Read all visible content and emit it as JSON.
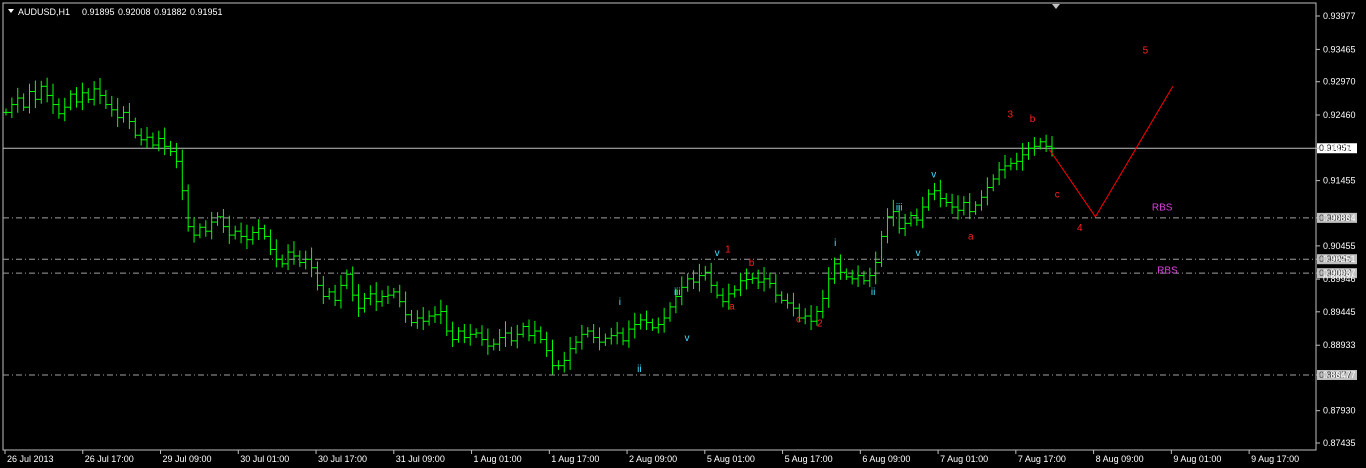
{
  "header": {
    "symbol": "AUDUSD,H1",
    "o": "0.91895",
    "h": "0.92008",
    "l": "0.91882",
    "c": "0.91951"
  },
  "colors": {
    "background": "#000000",
    "frame": "#c0c0c0",
    "bars": "#00ff00",
    "grid": "#c0c0c0",
    "projection": "#ff0000",
    "wave_red": "#ff2020",
    "wave_cyan": "#40e0ff",
    "wave_magenta": "#e040e0",
    "price_label_bg": "#ffffff",
    "price_label_text": "#000000"
  },
  "chart_data": {
    "type": "candlestick",
    "ylim": [
      0.87435,
      0.93977
    ],
    "y_ticks": [
      "0.93977",
      "0.93465",
      "0.92970",
      "0.92460",
      "0.91951",
      "0.91455",
      "0.90884",
      "0.90455",
      "0.90251",
      "0.90037",
      "0.89946",
      "0.89445",
      "0.88933",
      "0.88477",
      "0.87930",
      "0.87435"
    ],
    "x_ticks": [
      "26 Jul 2013",
      "26 Jul 17:00",
      "29 Jul 09:00",
      "30 Jul 01:00",
      "30 Jul 17:00",
      "31 Jul 09:00",
      "1 Aug 01:00",
      "1 Aug 17:00",
      "2 Aug 09:00",
      "5 Aug 01:00",
      "5 Aug 17:00",
      "6 Aug 09:00",
      "7 Aug 01:00",
      "7 Aug 17:00",
      "8 Aug 09:00",
      "9 Aug 01:00",
      "9 Aug 17:00"
    ],
    "current_price": "0.91951",
    "levels": [
      {
        "value": 0.90884,
        "label": "0.90884"
      },
      {
        "value": 0.90251,
        "label": "0.90251"
      },
      {
        "value": 0.90037,
        "label": "0.90037"
      },
      {
        "value": 0.88477,
        "label": "0.88477"
      }
    ],
    "closes": [
      0.925,
      0.9262,
      0.9272,
      0.9258,
      0.9282,
      0.927,
      0.929,
      0.9276,
      0.9262,
      0.9248,
      0.9258,
      0.9278,
      0.9266,
      0.928,
      0.927,
      0.9286,
      0.9276,
      0.9262,
      0.9254,
      0.9242,
      0.925,
      0.9236,
      0.9215,
      0.9208,
      0.9212,
      0.92,
      0.921,
      0.9198,
      0.919,
      0.9175,
      0.913,
      0.9075,
      0.9062,
      0.9074,
      0.9068,
      0.9082,
      0.909,
      0.9075,
      0.9062,
      0.9068,
      0.906,
      0.9055,
      0.9066,
      0.9072,
      0.906,
      0.904,
      0.9025,
      0.9018,
      0.9036,
      0.903,
      0.902,
      0.9025,
      0.9012,
      0.8985,
      0.8968,
      0.8975,
      0.8962,
      0.8985,
      0.9002,
      0.897,
      0.895,
      0.8965,
      0.8972,
      0.896,
      0.8968,
      0.897,
      0.8975,
      0.896,
      0.894,
      0.8928,
      0.8935,
      0.893,
      0.8938,
      0.894,
      0.8945,
      0.8915,
      0.8902,
      0.8915,
      0.8905,
      0.891,
      0.8912,
      0.8902,
      0.8892,
      0.8895,
      0.8905,
      0.8912,
      0.89,
      0.891,
      0.8922,
      0.8908,
      0.8915,
      0.8902,
      0.8885,
      0.8862,
      0.8862,
      0.887,
      0.8888,
      0.8898,
      0.891,
      0.8915,
      0.8905,
      0.8898,
      0.8904,
      0.8908,
      0.8912,
      0.89,
      0.8918,
      0.8925,
      0.8932,
      0.8928,
      0.892,
      0.8925,
      0.8935,
      0.8952,
      0.8968,
      0.8982,
      0.8995,
      0.899,
      0.9,
      0.9005,
      0.8985,
      0.897,
      0.896,
      0.8972,
      0.8978,
      0.8992,
      0.8994,
      0.8996,
      0.899,
      0.8995,
      0.8988,
      0.897,
      0.8962,
      0.8958,
      0.895,
      0.8935,
      0.8938,
      0.893,
      0.8945,
      0.8965,
      0.8995,
      0.9018,
      0.9005,
      0.8998,
      0.8995,
      0.9,
      0.8992,
      0.9,
      0.902,
      0.906,
      0.909,
      0.9098,
      0.9072,
      0.908,
      0.9092,
      0.9085,
      0.9105,
      0.9125,
      0.913,
      0.9118,
      0.9112,
      0.9105,
      0.91,
      0.9112,
      0.9098,
      0.9108,
      0.912,
      0.9135,
      0.9148,
      0.9162,
      0.9168,
      0.9172,
      0.9175,
      0.9185,
      0.9195,
      0.9198,
      0.9205,
      0.9198,
      0.9195
    ]
  },
  "waves": [
    {
      "text": "1",
      "color": "wave_red",
      "x": 0.55,
      "p": 0.9035
    },
    {
      "text": "2",
      "color": "wave_red",
      "x": 0.62,
      "p": 0.8922
    },
    {
      "text": "3",
      "color": "wave_red",
      "x": 0.765,
      "p": 0.9242
    },
    {
      "text": "4",
      "color": "wave_red",
      "x": 0.818,
      "p": 0.9068
    },
    {
      "text": "5",
      "color": "wave_red",
      "x": 0.868,
      "p": 0.934
    },
    {
      "text": "a",
      "color": "wave_red",
      "x": 0.553,
      "p": 0.8948
    },
    {
      "text": "b",
      "color": "wave_red",
      "x": 0.568,
      "p": 0.9015
    },
    {
      "text": "c",
      "color": "wave_red",
      "x": 0.604,
      "p": 0.8928
    },
    {
      "text": "a",
      "color": "wave_red",
      "x": 0.735,
      "p": 0.9055
    },
    {
      "text": "b",
      "color": "wave_red",
      "x": 0.782,
      "p": 0.9235
    },
    {
      "text": "c",
      "color": "wave_red",
      "x": 0.801,
      "p": 0.912
    },
    {
      "text": "i",
      "color": "wave_cyan",
      "x": 0.469,
      "p": 0.8955
    },
    {
      "text": "ii",
      "color": "wave_cyan",
      "x": 0.483,
      "p": 0.8852
    },
    {
      "text": "iii",
      "color": "wave_cyan",
      "x": 0.511,
      "p": 0.897
    },
    {
      "text": "v",
      "color": "wave_cyan",
      "x": 0.519,
      "p": 0.89
    },
    {
      "text": "v",
      "color": "wave_cyan",
      "x": 0.542,
      "p": 0.903
    },
    {
      "text": "i",
      "color": "wave_cyan",
      "x": 0.633,
      "p": 0.9045
    },
    {
      "text": "ii",
      "color": "wave_cyan",
      "x": 0.661,
      "p": 0.897
    },
    {
      "text": "iii",
      "color": "wave_cyan",
      "x": 0.68,
      "p": 0.91
    },
    {
      "text": "v",
      "color": "wave_cyan",
      "x": 0.695,
      "p": 0.903
    },
    {
      "text": "v",
      "color": "wave_cyan",
      "x": 0.707,
      "p": 0.915
    },
    {
      "text": "RBS",
      "color": "wave_magenta",
      "x": 0.875,
      "p": 0.91
    },
    {
      "text": "RBS",
      "color": "wave_magenta",
      "x": 0.879,
      "p": 0.9003
    }
  ],
  "projection": [
    {
      "x": 0.797,
      "p": 0.9193
    },
    {
      "x": 0.832,
      "p": 0.909
    },
    {
      "x": 0.891,
      "p": 0.929
    }
  ]
}
